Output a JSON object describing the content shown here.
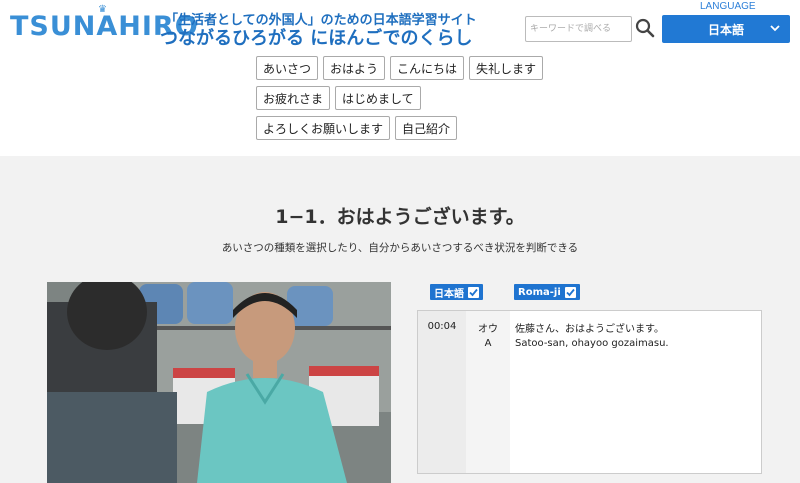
{
  "header": {
    "logo": "TSUNAHIRO",
    "subtitle": "「生活者としての外国人」のための日本語学習サイト",
    "title": "つながるひろがる にほんごでのくらし",
    "search_placeholder": "キーワードで調べる",
    "language_label": "LANGUAGE",
    "language_value": "日本語"
  },
  "tags": {
    "row1": [
      "あいさつ",
      "おはよう",
      "こんにちは",
      "失礼します"
    ],
    "row2": [
      "お疲れさま",
      "はじめまして"
    ],
    "row3": [
      "よろしくお願いします",
      "自己紹介"
    ]
  },
  "lesson": {
    "title": "1−1．おはようございます。",
    "description": "あいさつの種類を選択したり、自分からあいさつするべき状況を判断できる"
  },
  "toggles": {
    "japanese": "日本語",
    "romaji": "Roma-ji"
  },
  "transcript": {
    "rows": [
      {
        "time": "00:04",
        "speaker": "オウ",
        "text": "佐藤さん、おはようございます。"
      },
      {
        "time": "",
        "speaker": "A",
        "text": "Satoo-san, ohayoo gozaimasu."
      }
    ]
  },
  "colors": {
    "brand": "#2179d4",
    "logo": "#3a8fd6",
    "title": "#1f6fbf",
    "main_bg": "#f2f2f2"
  }
}
